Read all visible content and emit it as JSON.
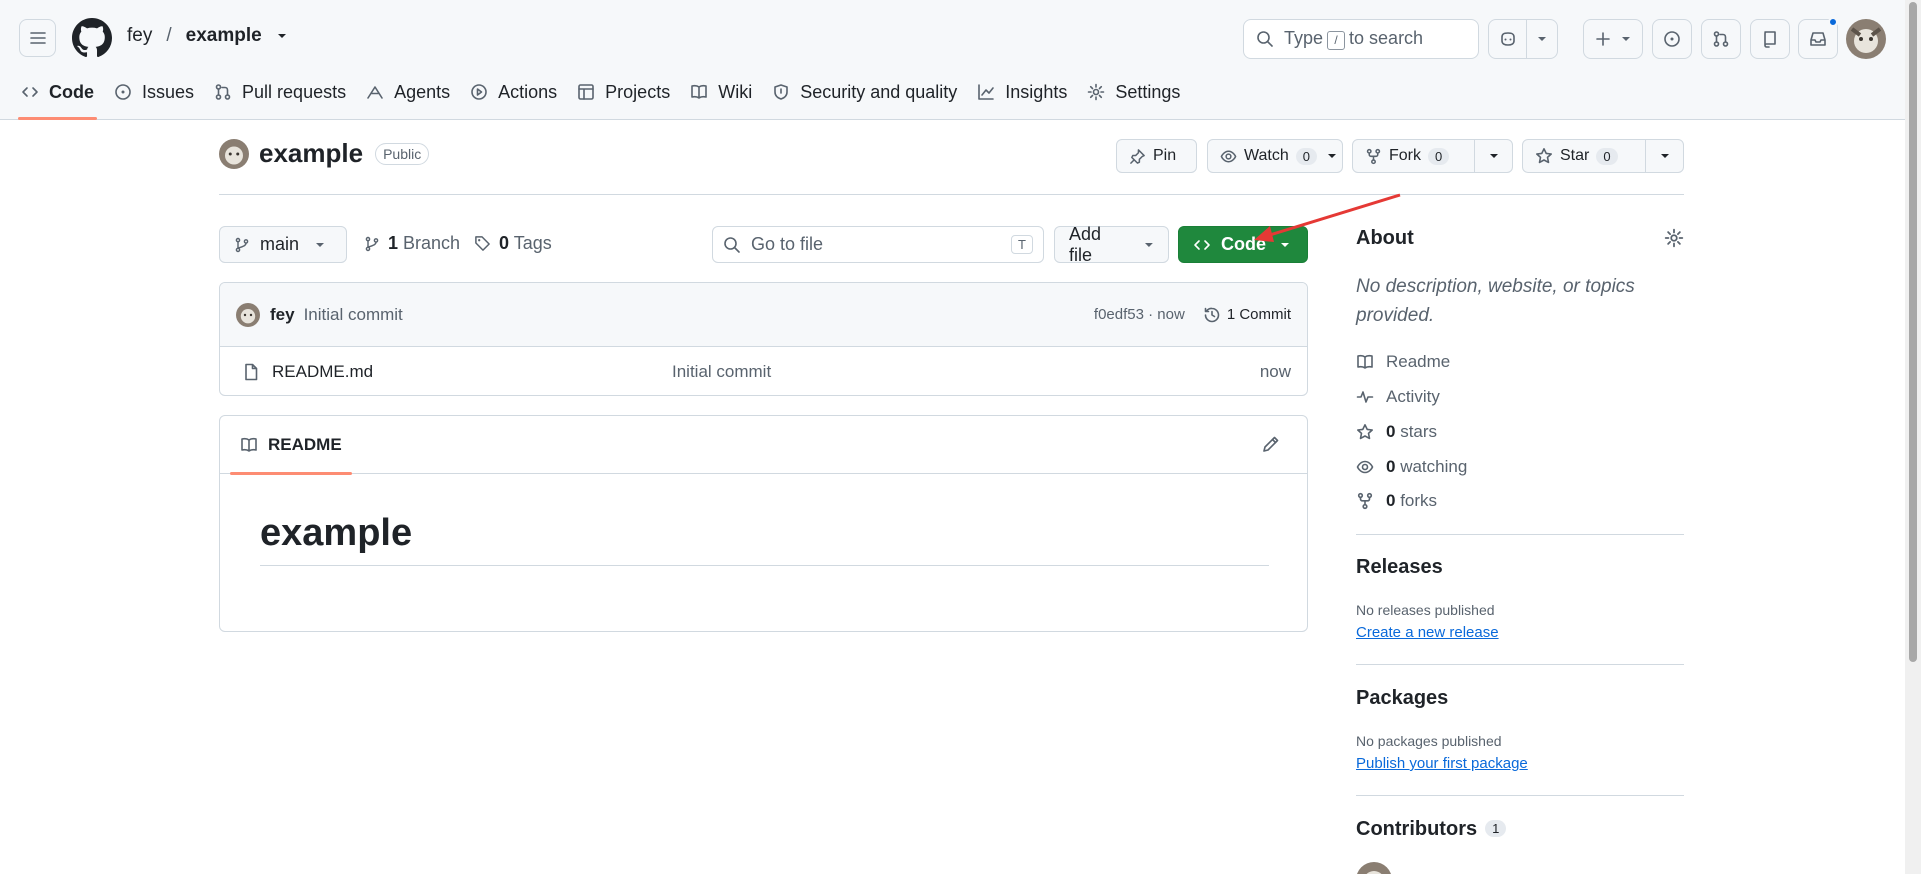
{
  "header": {
    "owner": "fey",
    "separator": "/",
    "repo": "example",
    "search_before": "Type",
    "search_key": "/",
    "search_after": "to search"
  },
  "nav": {
    "code": "Code",
    "issues": "Issues",
    "pulls": "Pull requests",
    "agents": "Agents",
    "actions": "Actions",
    "projects": "Projects",
    "wiki": "Wiki",
    "security": "Security and quality",
    "insights": "Insights",
    "settings": "Settings"
  },
  "repo": {
    "name": "example",
    "visibility": "Public",
    "pin_label": "Pin",
    "watch_label": "Watch",
    "watch_count": "0",
    "fork_label": "Fork",
    "fork_count": "0",
    "star_label": "Star",
    "star_count": "0"
  },
  "toolbar": {
    "branch": "main",
    "branch_count": "1",
    "branch_label": "Branch",
    "tag_count": "0",
    "tag_label": "Tags",
    "goto_placeholder": "Go to file",
    "goto_key": "T",
    "add_file": "Add file",
    "code_label": "Code"
  },
  "commit": {
    "author": "fey",
    "message": "Initial commit",
    "hash_time": "f0edf53 · now",
    "count": "1 Commit"
  },
  "files": [
    {
      "name": "README.md",
      "message": "Initial commit",
      "time": "now"
    }
  ],
  "readme": {
    "tab": "README",
    "heading": "example"
  },
  "sidebar": {
    "about_title": "About",
    "about_desc": "No description, website, or topics provided.",
    "readme": "Readme",
    "activity": "Activity",
    "stars_count": "0",
    "stars_label": "stars",
    "watching_count": "0",
    "watching_label": "watching",
    "forks_count": "0",
    "forks_label": "forks",
    "releases_title": "Releases",
    "releases_none": "No releases published",
    "releases_link": "Create a new release",
    "packages_title": "Packages",
    "packages_none": "No packages published",
    "packages_link": "Publish your first package",
    "contributors_title": "Contributors",
    "contributors_count": "1"
  },
  "colors": {
    "accent_green": "#1f883d",
    "link_blue": "#0969da",
    "tab_underline": "#fd8c73",
    "annotation_arrow": "#e53935"
  }
}
